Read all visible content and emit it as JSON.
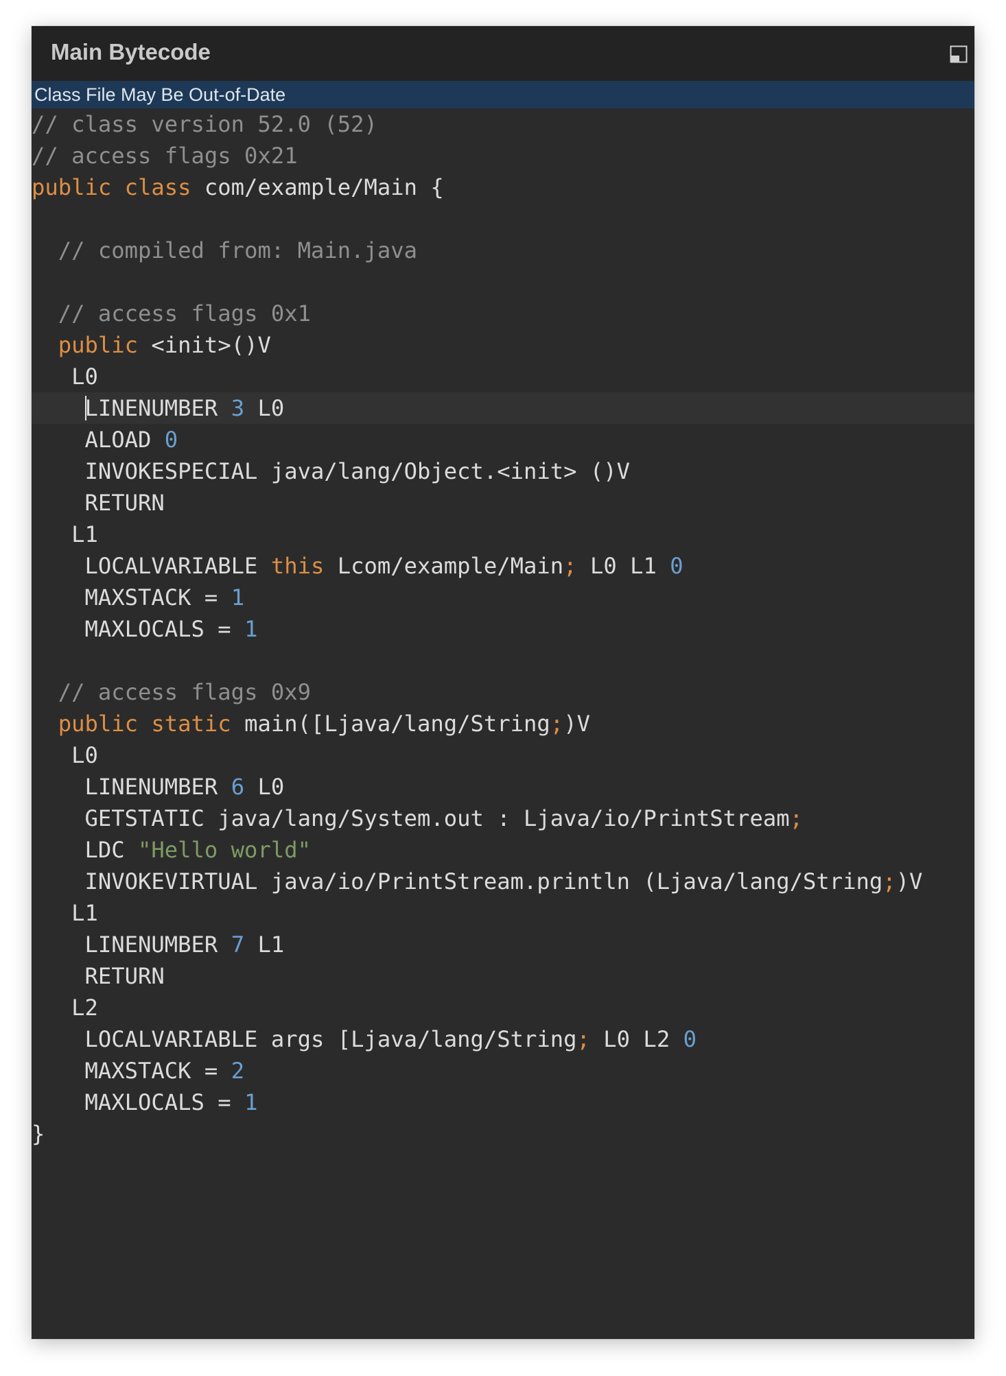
{
  "window": {
    "title": "Main Bytecode",
    "maximize_icon": "maximize-icon"
  },
  "banner": {
    "text": "Class File May Be Out-of-Date"
  },
  "editor": {
    "caret_line": 9,
    "colors": {
      "comment": "#8f8f8f",
      "keyword": "#de8f43",
      "number": "#6a9fd0",
      "string": "#7f9a62",
      "plain": "#dcdcdc",
      "background": "#2b2b2c",
      "banner": "#1e3957"
    },
    "lines": [
      [
        [
          "cm",
          "// class version 52.0 (52)"
        ]
      ],
      [
        [
          "cm",
          "// access flags 0x21"
        ]
      ],
      [
        [
          "kw",
          "public class "
        ],
        [
          "pl",
          "com/example/Main {"
        ]
      ],
      [],
      [
        [
          "pl",
          "  "
        ],
        [
          "cm",
          "// compiled from: Main.java"
        ]
      ],
      [],
      [
        [
          "pl",
          "  "
        ],
        [
          "cm",
          "// access flags 0x1"
        ]
      ],
      [
        [
          "pl",
          "  "
        ],
        [
          "kw",
          "public "
        ],
        [
          "pl",
          "<init>()V"
        ]
      ],
      [
        [
          "pl",
          "   L0"
        ]
      ],
      [
        [
          "pl",
          "    LINENUMBER "
        ],
        [
          "num",
          "3"
        ],
        [
          "pl",
          " L0"
        ]
      ],
      [
        [
          "pl",
          "    ALOAD "
        ],
        [
          "num",
          "0"
        ]
      ],
      [
        [
          "pl",
          "    INVOKESPECIAL java/lang/Object.<init> ()V"
        ]
      ],
      [
        [
          "pl",
          "    RETURN"
        ]
      ],
      [
        [
          "pl",
          "   L1"
        ]
      ],
      [
        [
          "pl",
          "    LOCALVARIABLE "
        ],
        [
          "kw",
          "this"
        ],
        [
          "pl",
          " Lcom/example/Main"
        ],
        [
          "kw",
          ";"
        ],
        [
          "pl",
          " L0 L1 "
        ],
        [
          "num",
          "0"
        ]
      ],
      [
        [
          "pl",
          "    MAXSTACK = "
        ],
        [
          "num",
          "1"
        ]
      ],
      [
        [
          "pl",
          "    MAXLOCALS = "
        ],
        [
          "num",
          "1"
        ]
      ],
      [],
      [
        [
          "pl",
          "  "
        ],
        [
          "cm",
          "// access flags 0x9"
        ]
      ],
      [
        [
          "pl",
          "  "
        ],
        [
          "kw",
          "public static "
        ],
        [
          "pl",
          "main([Ljava/lang/String"
        ],
        [
          "kw",
          ";"
        ],
        [
          "pl",
          ")V"
        ]
      ],
      [
        [
          "pl",
          "   L0"
        ]
      ],
      [
        [
          "pl",
          "    LINENUMBER "
        ],
        [
          "num",
          "6"
        ],
        [
          "pl",
          " L0"
        ]
      ],
      [
        [
          "pl",
          "    GETSTATIC java/lang/System.out : Ljava/io/PrintStream"
        ],
        [
          "kw",
          ";"
        ]
      ],
      [
        [
          "pl",
          "    LDC "
        ],
        [
          "str",
          "\"Hello world\""
        ]
      ],
      [
        [
          "pl",
          "    INVOKEVIRTUAL java/io/PrintStream.println (Ljava/lang/String"
        ],
        [
          "kw",
          ";"
        ],
        [
          "pl",
          ")V"
        ]
      ],
      [
        [
          "pl",
          "   L1"
        ]
      ],
      [
        [
          "pl",
          "    LINENUMBER "
        ],
        [
          "num",
          "7"
        ],
        [
          "pl",
          " L1"
        ]
      ],
      [
        [
          "pl",
          "    RETURN"
        ]
      ],
      [
        [
          "pl",
          "   L2"
        ]
      ],
      [
        [
          "pl",
          "    LOCALVARIABLE args [Ljava/lang/String"
        ],
        [
          "kw",
          ";"
        ],
        [
          "pl",
          " L0 L2 "
        ],
        [
          "num",
          "0"
        ]
      ],
      [
        [
          "pl",
          "    MAXSTACK = "
        ],
        [
          "num",
          "2"
        ]
      ],
      [
        [
          "pl",
          "    MAXLOCALS = "
        ],
        [
          "num",
          "1"
        ]
      ],
      [
        [
          "pl",
          "}"
        ]
      ]
    ]
  }
}
